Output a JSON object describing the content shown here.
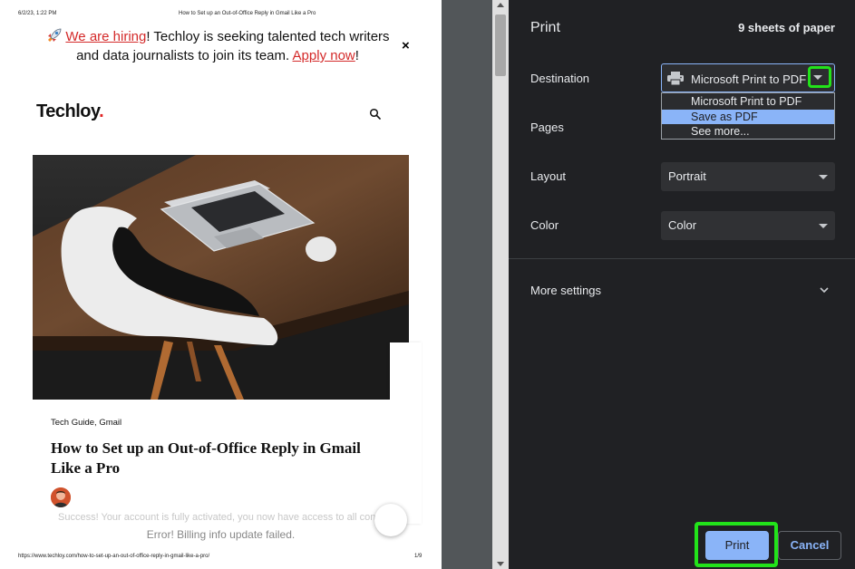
{
  "preview": {
    "header_date": "6/2/23, 1:22 PM",
    "header_title": "How to Set up an Out-of-Office Reply in Gmail Like a Pro",
    "footer_url": "https://www.techloy.com/how-to-set-up-an-out-of-office-reply-in-gmail-like-a-pro/",
    "footer_page": "1/9",
    "banner": {
      "link1": "We are hiring",
      "text1": "! Techloy is seeking talented tech writers and data journalists to join its team. ",
      "link2": "Apply now",
      "text2": "!",
      "close": "×"
    },
    "logo_text": "Techloy",
    "logo_dot": ".",
    "article": {
      "categories": "Tech Guide,  Gmail",
      "title": "How to Set up an Out-of-Office Reply in Gmail Like a Pro"
    },
    "success_message": "Success! Your account is fully activated, you now have access to all content.",
    "error_message": "Error! Billing info update failed."
  },
  "print_panel": {
    "title": "Print",
    "sheet_count": "9 sheets of paper",
    "destination_label": "Destination",
    "destination_value": "Microsoft Print to PDF",
    "destination_options": [
      "Microsoft Print to PDF",
      "Save as PDF",
      "See more..."
    ],
    "highlighted_option": "Save as PDF",
    "pages_label": "Pages",
    "layout_label": "Layout",
    "layout_value": "Portrait",
    "color_label": "Color",
    "color_value": "Color",
    "more_settings": "More settings",
    "print_button": "Print",
    "cancel_button": "Cancel"
  },
  "colors": {
    "panel_bg": "#202124",
    "accent": "#8ab4f8",
    "highlight_outline": "#22e31a",
    "brand_red": "#e02424"
  },
  "icons": [
    "rocket-icon",
    "close-icon",
    "search-icon",
    "printer-icon",
    "caret-down-icon",
    "chevron-down-icon"
  ]
}
